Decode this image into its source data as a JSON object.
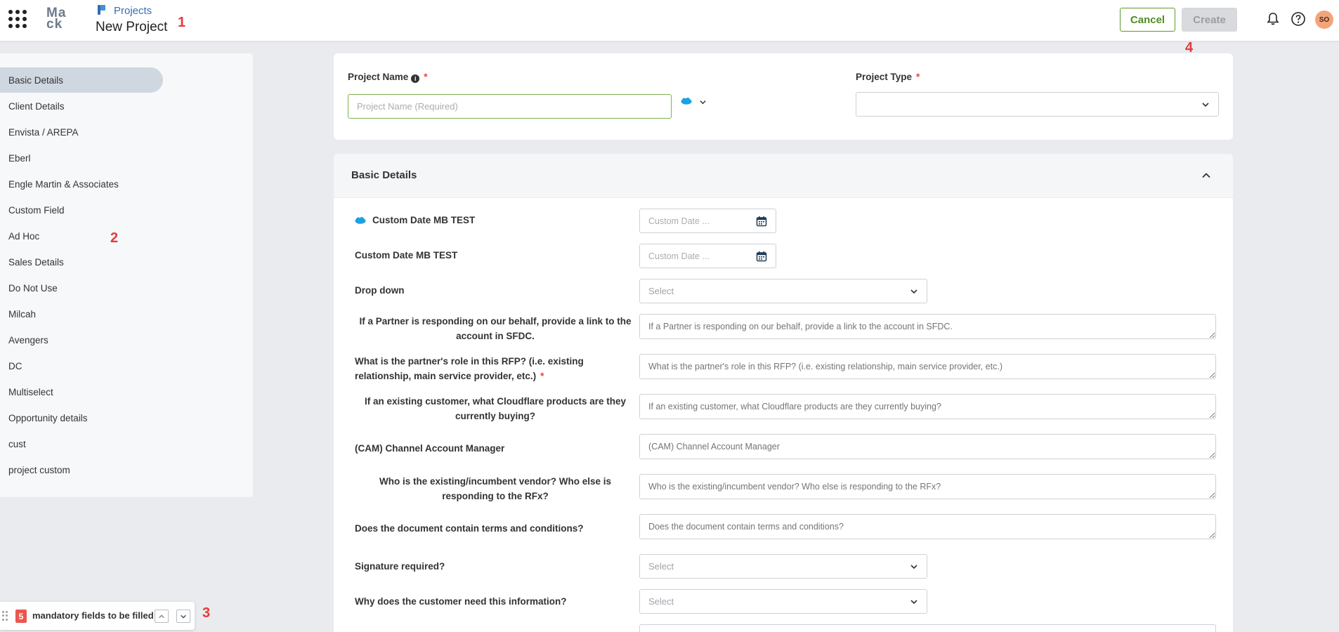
{
  "header": {
    "breadcrumb": "Projects",
    "title": "New Project",
    "cancel_label": "Cancel",
    "create_label": "Create",
    "avatar_initials": "SO",
    "logo_line1": "Ma",
    "logo_line2": "ck"
  },
  "annotations": {
    "a1": "1",
    "a2": "2",
    "a3": "3",
    "a4": "4"
  },
  "sidebar": {
    "items": [
      {
        "label": "Basic Details",
        "active": true
      },
      {
        "label": "Client Details"
      },
      {
        "label": "Envista / AREPA"
      },
      {
        "label": "Eberl"
      },
      {
        "label": "Engle Martin & Associates"
      },
      {
        "label": "Custom Field"
      },
      {
        "label": "Ad Hoc"
      },
      {
        "label": "Sales Details"
      },
      {
        "label": "Do Not Use"
      },
      {
        "label": "Milcah"
      },
      {
        "label": "Avengers"
      },
      {
        "label": "DC"
      },
      {
        "label": "Multiselect"
      },
      {
        "label": "Opportunity details"
      },
      {
        "label": "cust"
      },
      {
        "label": "project custom"
      }
    ]
  },
  "project": {
    "name_label": "Project Name",
    "name_placeholder": "Project Name (Required)",
    "type_label": "Project Type",
    "required_mark": "*",
    "info_glyph": "i"
  },
  "basic_details": {
    "title": "Basic Details",
    "fields": {
      "custom_date_1": {
        "label": "Custom Date MB TEST",
        "placeholder": "Custom Date ..."
      },
      "custom_date_2": {
        "label": "Custom Date MB TEST",
        "placeholder": "Custom Date ..."
      },
      "drop_down": {
        "label": "Drop down",
        "value": "Select"
      },
      "partner_link": {
        "label": "If a Partner is responding on our behalf, provide a link to the account in SFDC.",
        "placeholder": "If a Partner is responding on our behalf, provide a link to the account in SFDC."
      },
      "partner_role": {
        "label": "What is the partner's role in this RFP? (i.e. existing relationship, main service provider, etc.)",
        "placeholder": "What is the partner's role in this RFP? (i.e. existing relationship, main service provider, etc.)"
      },
      "cloudflare_products": {
        "label": "If an existing customer, what Cloudflare products are they currently buying?",
        "placeholder": "If an existing customer, what Cloudflare products are they currently buying?"
      },
      "cam": {
        "label": "(CAM) Channel Account Manager",
        "placeholder": "(CAM) Channel Account Manager"
      },
      "incumbent_vendor": {
        "label": "Who is the existing/incumbent vendor? Who else is responding to the RFx?",
        "placeholder": "Who is the existing/incumbent vendor? Who else is responding to the RFx?"
      },
      "terms": {
        "label": "Does the document contain terms and conditions?",
        "placeholder": "Does the document contain terms and conditions?"
      },
      "signature": {
        "label": "Signature required?",
        "value": "Select"
      },
      "why_info": {
        "label": "Why does the customer need this information?",
        "value": "Select"
      }
    }
  },
  "mandatory": {
    "count": "5",
    "text": "mandatory fields to be filled"
  },
  "colors": {
    "accent_green": "#4f8d1f",
    "required_red": "#e0453a",
    "annotation_red": "#e53b3b",
    "salesforce_blue": "#1ba1e2"
  }
}
